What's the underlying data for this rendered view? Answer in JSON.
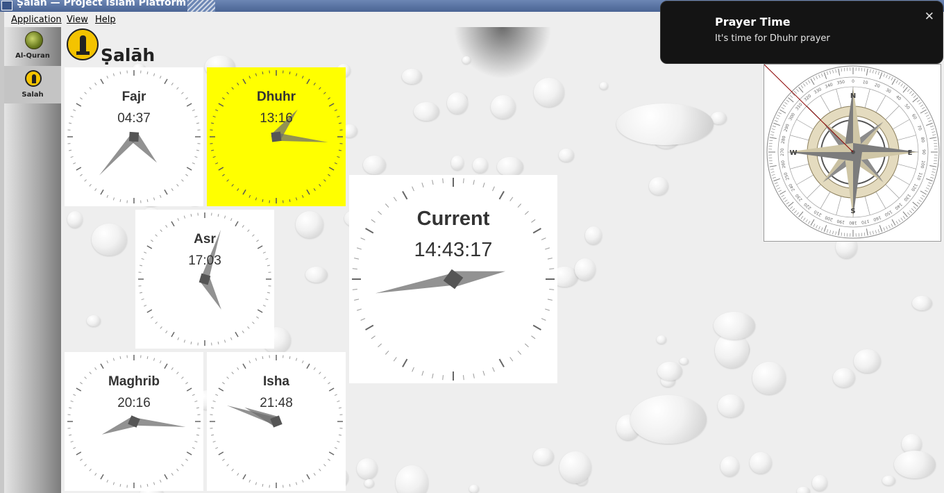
{
  "window": {
    "title": "Ṣalāh — Project Islam Platform"
  },
  "menu": {
    "items": [
      "Application",
      "View",
      "Help"
    ]
  },
  "sidebar": {
    "items": [
      {
        "label": "Al-Quran",
        "icon": "quran-icon",
        "active": false
      },
      {
        "label": "Salah",
        "icon": "minaret-icon",
        "active": true
      }
    ]
  },
  "page": {
    "title": "Ṣalāh",
    "logo_icon": "minaret-icon"
  },
  "prayers": [
    {
      "name": "Fajr",
      "time": "04:37",
      "active": false
    },
    {
      "name": "Dhuhr",
      "time": "13:16",
      "active": true
    },
    {
      "name": "Asr",
      "time": "17:03",
      "active": false
    },
    {
      "name": "Maghrib",
      "time": "20:16",
      "active": false
    },
    {
      "name": "Isha",
      "time": "21:48",
      "active": false
    }
  ],
  "current": {
    "label": "Current",
    "time": "14:43:17"
  },
  "compass": {
    "cardinals": [
      "N",
      "E",
      "S",
      "W"
    ],
    "degree_labels": [
      "0",
      "10",
      "20",
      "30",
      "40",
      "50",
      "60",
      "70",
      "80",
      "90",
      "100",
      "110",
      "120",
      "130",
      "140",
      "150",
      "160",
      "170",
      "180",
      "190",
      "200",
      "210",
      "220",
      "230",
      "240",
      "250",
      "260",
      "270",
      "280",
      "290",
      "300",
      "310",
      "320",
      "330",
      "340",
      "350"
    ]
  },
  "notification": {
    "title": "Prayer Time",
    "body": "It's time for Dhuhr prayer",
    "close": "✕"
  },
  "colors": {
    "active_prayer": "#ffff00",
    "hand": "#6e6e6e",
    "notification_bg": "#141414"
  }
}
